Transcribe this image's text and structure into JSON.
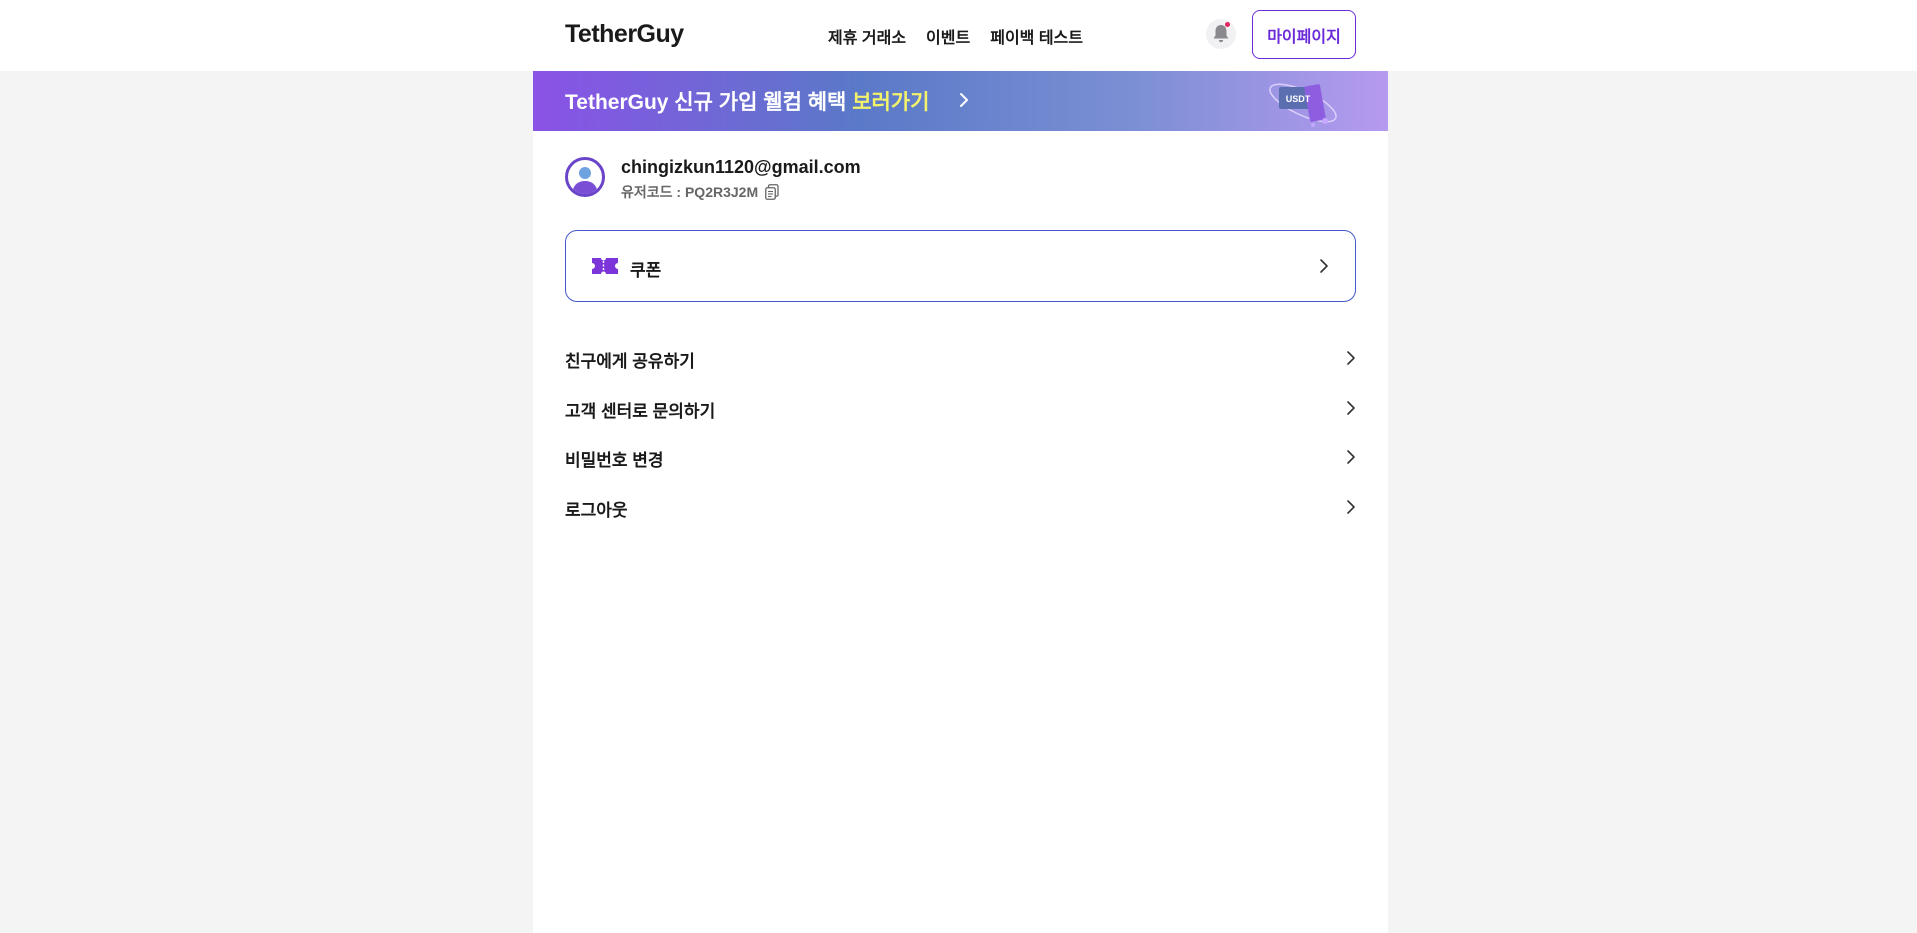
{
  "header": {
    "logo": "TetherGuy",
    "nav": [
      "제휴 거래소",
      "이벤트",
      "페이백 테스트"
    ],
    "mypage_label": "마이페이지"
  },
  "banner": {
    "brand": "TetherGuy",
    "text": " 신규 가입 웰컴 혜택 ",
    "highlight": "보러가기",
    "badge": "USDT"
  },
  "profile": {
    "email": "chingizkun1120@gmail.com",
    "usercode_label": "유저코드 : ",
    "usercode": "PQ2R3J2M"
  },
  "coupon": {
    "label": "쿠폰"
  },
  "menu": [
    {
      "label": "친구에게 공유하기"
    },
    {
      "label": "고객 센터로 문의하기"
    },
    {
      "label": "비밀번호 변경"
    },
    {
      "label": "로그아웃"
    }
  ],
  "colors": {
    "accent": "#6c2bd9",
    "coupon_border": "#4357c9",
    "banner_highlight": "#f3f26a",
    "page_background": "#f4f4f4"
  },
  "icons": [
    "bell-icon",
    "chevron-right-icon",
    "ticket-icon",
    "copy-icon",
    "user-avatar-icon"
  ]
}
